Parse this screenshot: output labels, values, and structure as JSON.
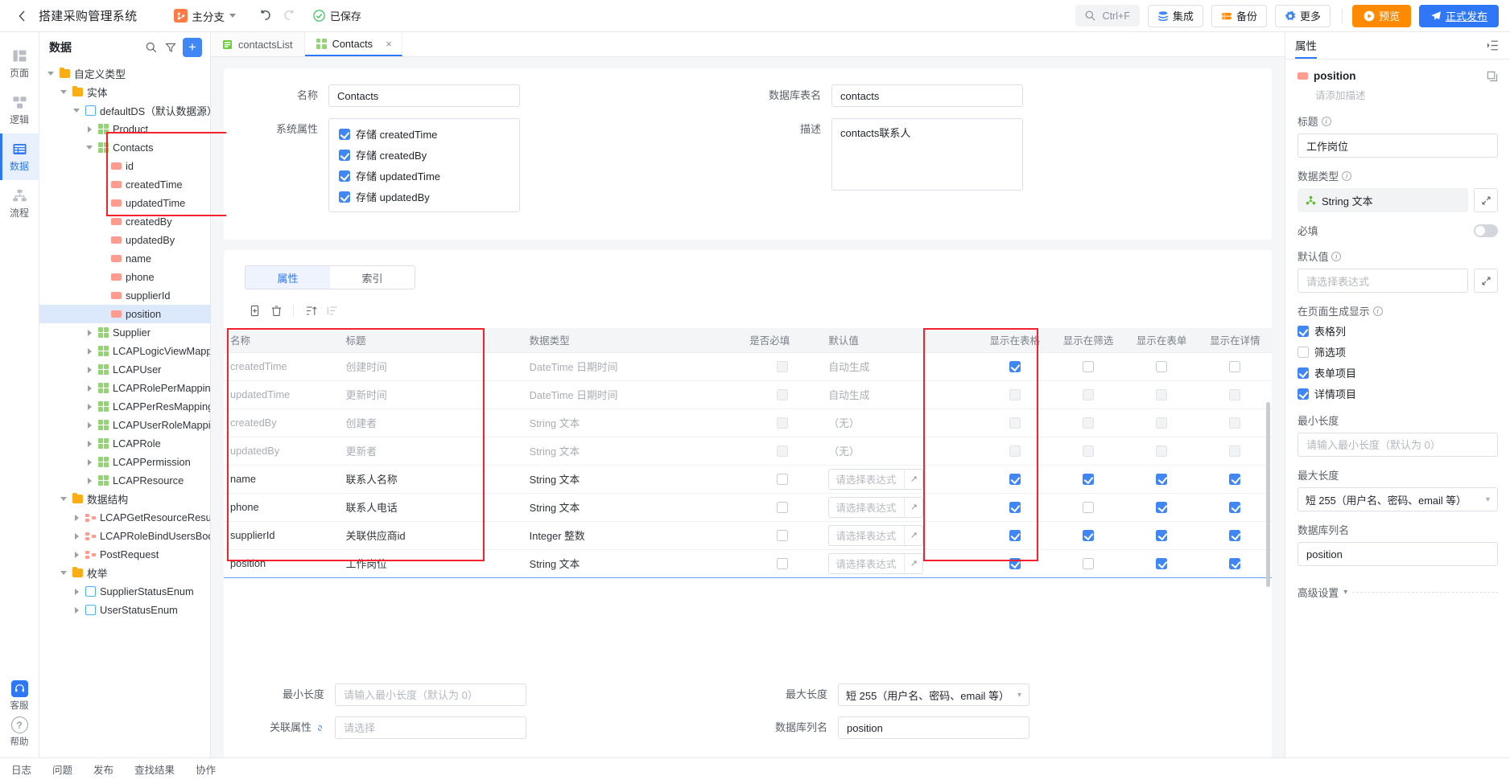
{
  "topbar": {
    "back_icon": "chevron-left-icon",
    "project_title": "搭建采购管理系统",
    "branch_label": "主分支",
    "branch_icon": "branch-icon",
    "undo_icon": "undo-icon",
    "redo_icon": "redo-icon",
    "saved_icon": "check-circle-icon",
    "saved_label": "已保存",
    "search_shortcut": "Ctrl+F",
    "search_icon": "search-icon",
    "integration_label": "集成",
    "integration_icon": "database-stack-icon",
    "backup_label": "备份",
    "backup_icon": "server-icon",
    "more_label": "更多",
    "more_icon": "gear-icon",
    "preview_label": "预览",
    "preview_icon": "play-circle-icon",
    "publish_label": "正式发布",
    "publish_icon": "send-icon",
    "accent_orange": "#ff8a00",
    "accent_blue": "#2e77f6"
  },
  "rail": {
    "items": [
      {
        "label": "页面",
        "icon": "layout-icon",
        "active": false
      },
      {
        "label": "逻辑",
        "icon": "logic-icon",
        "active": false
      },
      {
        "label": "数据",
        "icon": "data-table-icon",
        "active": true
      },
      {
        "label": "流程",
        "icon": "flow-icon",
        "active": false
      }
    ],
    "bottom": [
      {
        "label": "客服",
        "icon": "customer-service-icon"
      },
      {
        "label": "帮助",
        "icon": "question-mark-icon"
      }
    ]
  },
  "tree_panel": {
    "title": "数据",
    "search_icon": "search-icon",
    "filter_icon": "filter-icon",
    "add_icon": "plus-icon",
    "nodes": [
      {
        "label": "自定义类型",
        "depth": 0,
        "twisty": "down",
        "icon": "folder-icon"
      },
      {
        "label": "实体",
        "depth": 1,
        "twisty": "down",
        "icon": "folder-icon"
      },
      {
        "label": "defaultDS（默认数据源）",
        "depth": 2,
        "twisty": "down",
        "icon": "datasource-icon"
      },
      {
        "label": "Product",
        "depth": 3,
        "twisty": "right",
        "icon": "entity-icon"
      },
      {
        "label": "Contacts",
        "depth": 3,
        "twisty": "down",
        "icon": "entity-icon"
      },
      {
        "label": "id",
        "depth": 4,
        "twisty": "none",
        "icon": "field-icon"
      },
      {
        "label": "createdTime",
        "depth": 4,
        "twisty": "none",
        "icon": "field-icon"
      },
      {
        "label": "updatedTime",
        "depth": 4,
        "twisty": "none",
        "icon": "field-icon"
      },
      {
        "label": "createdBy",
        "depth": 4,
        "twisty": "none",
        "icon": "field-icon"
      },
      {
        "label": "updatedBy",
        "depth": 4,
        "twisty": "none",
        "icon": "field-icon"
      },
      {
        "label": "name",
        "depth": 4,
        "twisty": "none",
        "icon": "field-icon"
      },
      {
        "label": "phone",
        "depth": 4,
        "twisty": "none",
        "icon": "field-icon"
      },
      {
        "label": "supplierId",
        "depth": 4,
        "twisty": "none",
        "icon": "field-icon"
      },
      {
        "label": "position",
        "depth": 4,
        "twisty": "none",
        "icon": "field-icon",
        "selected": true
      },
      {
        "label": "Supplier",
        "depth": 3,
        "twisty": "right",
        "icon": "entity-icon"
      },
      {
        "label": "LCAPLogicViewMapping",
        "depth": 3,
        "twisty": "right",
        "icon": "entity-icon"
      },
      {
        "label": "LCAPUser",
        "depth": 3,
        "twisty": "right",
        "icon": "entity-icon"
      },
      {
        "label": "LCAPRolePerMapping",
        "depth": 3,
        "twisty": "right",
        "icon": "entity-icon"
      },
      {
        "label": "LCAPPerResMapping",
        "depth": 3,
        "twisty": "right",
        "icon": "entity-icon"
      },
      {
        "label": "LCAPUserRoleMapping",
        "depth": 3,
        "twisty": "right",
        "icon": "entity-icon"
      },
      {
        "label": "LCAPRole",
        "depth": 3,
        "twisty": "right",
        "icon": "entity-icon"
      },
      {
        "label": "LCAPPermission",
        "depth": 3,
        "twisty": "right",
        "icon": "entity-icon"
      },
      {
        "label": "LCAPResource",
        "depth": 3,
        "twisty": "right",
        "icon": "entity-icon"
      },
      {
        "label": "数据结构",
        "depth": 1,
        "twisty": "down",
        "icon": "folder-icon"
      },
      {
        "label": "LCAPGetResourceResult",
        "depth": 2,
        "twisty": "right",
        "icon": "struct-icon"
      },
      {
        "label": "LCAPRoleBindUsersBody",
        "depth": 2,
        "twisty": "right",
        "icon": "struct-icon"
      },
      {
        "label": "PostRequest",
        "depth": 2,
        "twisty": "right",
        "icon": "struct-icon"
      },
      {
        "label": "枚举",
        "depth": 1,
        "twisty": "down",
        "icon": "folder-icon"
      },
      {
        "label": "SupplierStatusEnum",
        "depth": 2,
        "twisty": "right",
        "icon": "enum-icon"
      },
      {
        "label": "UserStatusEnum",
        "depth": 2,
        "twisty": "right",
        "icon": "enum-icon"
      }
    ]
  },
  "tabs": [
    {
      "label": "contactsList",
      "icon": "page-icon",
      "active": false,
      "closable": false
    },
    {
      "label": "Contacts",
      "icon": "entity-icon",
      "active": true,
      "closable": true,
      "close_icon": "close-icon"
    }
  ],
  "entity_form": {
    "name_label": "名称",
    "name_value": "Contacts",
    "table_label": "数据库表名",
    "table_value": "contacts",
    "sysattr_label": "系统属性",
    "sysattrs": [
      {
        "label": "存储 createdTime",
        "checked": true
      },
      {
        "label": "存储 createdBy",
        "checked": true
      },
      {
        "label": "存储 updatedTime",
        "checked": true
      },
      {
        "label": "存储 updatedBy",
        "checked": true
      }
    ],
    "desc_label": "描述",
    "desc_value": "contacts联系人"
  },
  "attr_section": {
    "tabs": [
      {
        "label": "属性",
        "active": true
      },
      {
        "label": "索引",
        "active": false
      }
    ],
    "tools": [
      {
        "icon": "add-column-icon",
        "disabled": false
      },
      {
        "icon": "trash-icon",
        "disabled": false
      },
      {
        "icon": "sort-asc-icon",
        "disabled": false
      },
      {
        "icon": "sort-list-icon",
        "disabled": true
      }
    ],
    "columns": [
      "名称",
      "标题",
      "数据类型",
      "是否必填",
      "默认值",
      "显示在表格",
      "显示在筛选",
      "显示在表单",
      "显示在详情"
    ],
    "rows": [
      {
        "name": "createdTime",
        "title": "创建时间",
        "type": "DateTime 日期时间",
        "required": false,
        "required_disabled": true,
        "default_text": "自动生成",
        "default_kind": "text",
        "in_table": true,
        "in_filter": false,
        "in_form": false,
        "in_detail": false,
        "muted": true,
        "boxes_disabled": false
      },
      {
        "name": "updatedTime",
        "title": "更新时间",
        "type": "DateTime 日期时间",
        "required": false,
        "required_disabled": true,
        "default_text": "自动生成",
        "default_kind": "text",
        "in_table": false,
        "in_filter": false,
        "in_form": false,
        "in_detail": false,
        "muted": true,
        "boxes_disabled": true
      },
      {
        "name": "createdBy",
        "title": "创建者",
        "type": "String 文本",
        "required": false,
        "required_disabled": true,
        "default_text": "（无）",
        "default_kind": "text",
        "in_table": false,
        "in_filter": false,
        "in_form": false,
        "in_detail": false,
        "muted": true,
        "boxes_disabled": true
      },
      {
        "name": "updatedBy",
        "title": "更新者",
        "type": "String 文本",
        "required": false,
        "required_disabled": true,
        "default_text": "（无）",
        "default_kind": "text",
        "in_table": false,
        "in_filter": false,
        "in_form": false,
        "in_detail": false,
        "muted": true,
        "boxes_disabled": true
      },
      {
        "name": "name",
        "title": "联系人名称",
        "type": "String 文本",
        "required": false,
        "required_disabled": false,
        "default_text": "请选择表达式",
        "default_kind": "expr",
        "in_table": true,
        "in_filter": true,
        "in_form": true,
        "in_detail": true,
        "muted": false,
        "boxes_disabled": false
      },
      {
        "name": "phone",
        "title": "联系人电话",
        "type": "String 文本",
        "required": false,
        "required_disabled": false,
        "default_text": "请选择表达式",
        "default_kind": "expr",
        "in_table": true,
        "in_filter": false,
        "in_form": true,
        "in_detail": true,
        "muted": false,
        "boxes_disabled": false
      },
      {
        "name": "supplierId",
        "title": "关联供应商id",
        "type": "Integer 整数",
        "required": false,
        "required_disabled": false,
        "default_text": "请选择表达式",
        "default_kind": "expr",
        "in_table": true,
        "in_filter": true,
        "in_form": true,
        "in_detail": true,
        "muted": false,
        "boxes_disabled": false
      },
      {
        "name": "position",
        "title": "工作岗位",
        "type": "String 文本",
        "required": false,
        "required_disabled": false,
        "default_text": "请选择表达式",
        "default_kind": "expr",
        "in_table": true,
        "in_filter": false,
        "in_form": true,
        "in_detail": true,
        "muted": false,
        "boxes_disabled": false,
        "selected": true
      }
    ],
    "expr_expand_icon": "expand-icon"
  },
  "detail_form": {
    "minlen_label": "最小长度",
    "minlen_placeholder": "请输入最小长度（默认为 0）",
    "maxlen_label": "最大长度",
    "maxlen_value": "短 255（用户名、密码、email 等）",
    "relattr_label": "关联属性",
    "relattr_icon": "link-icon",
    "relattr_placeholder": "请选择",
    "dbcol_label": "数据库列名",
    "dbcol_value": "position"
  },
  "right_panel": {
    "tab_label": "属性",
    "collapse_icon": "collapse-panel-icon",
    "field_icon": "field-icon",
    "field_name": "position",
    "copy_icon": "copy-icon",
    "desc_placeholder": "请添加描述",
    "title_label": "标题",
    "title_value": "工作岗位",
    "datatype_label": "数据类型",
    "datatype_value": "String 文本",
    "datatype_icon": "type-string-icon",
    "expand_icon": "expand-icon",
    "required_label": "必填",
    "required_on": false,
    "default_label": "默认值",
    "default_placeholder": "请选择表达式",
    "pagegen_label": "在页面生成显示",
    "pagegen_items": [
      {
        "label": "表格列",
        "checked": true,
        "disabled": false
      },
      {
        "label": "筛选项",
        "checked": false,
        "disabled": false
      },
      {
        "label": "表单项目",
        "checked": true,
        "disabled": false
      },
      {
        "label": "详情项目",
        "checked": true,
        "disabled": false
      }
    ],
    "minlen_label": "最小长度",
    "minlen_placeholder": "请输入最小长度（默认为 0）",
    "maxlen_label": "最大长度",
    "maxlen_value": "短 255（用户名、密码、email 等）",
    "dbcol_label": "数据库列名",
    "dbcol_value": "position",
    "advanced_label": "高级设置",
    "advanced_icon": "chevron-down-icon"
  },
  "footer": {
    "items": [
      "日志",
      "问题",
      "发布",
      "查找结果",
      "协作"
    ]
  },
  "highlights": {
    "color": "#f5222d"
  }
}
